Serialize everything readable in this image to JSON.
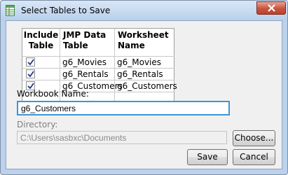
{
  "window": {
    "title": "Select Tables to Save",
    "close_symbol": "×"
  },
  "table": {
    "headers": [
      {
        "lines": [
          "Include",
          "Table"
        ]
      },
      {
        "lines": [
          "JMP Data",
          "Table"
        ]
      },
      {
        "lines": [
          "Worksheet",
          "Name"
        ]
      }
    ],
    "rows": [
      {
        "include": true,
        "data_table": "g6_Movies",
        "worksheet": "g6_Movies"
      },
      {
        "include": true,
        "data_table": "g6_Rentals",
        "worksheet": "g6_Rentals"
      },
      {
        "include": true,
        "data_table": "g6_Customers",
        "worksheet": "g6_Customers"
      }
    ]
  },
  "workbook": {
    "label": "Workbook Name:",
    "value": "g6_Customers"
  },
  "directory": {
    "label": "Directory:",
    "value": "C:\\Users\\sasbxc\\Documents",
    "choose_label": "Choose..."
  },
  "buttons": {
    "save_label": "Save",
    "cancel_label": "Cancel"
  },
  "icons": {
    "app": "jmp-table-icon",
    "close": "close-icon",
    "check": "checkmark-icon"
  },
  "colors": {
    "focus_border": "#3d95d8",
    "close_button": "#c7543d"
  }
}
